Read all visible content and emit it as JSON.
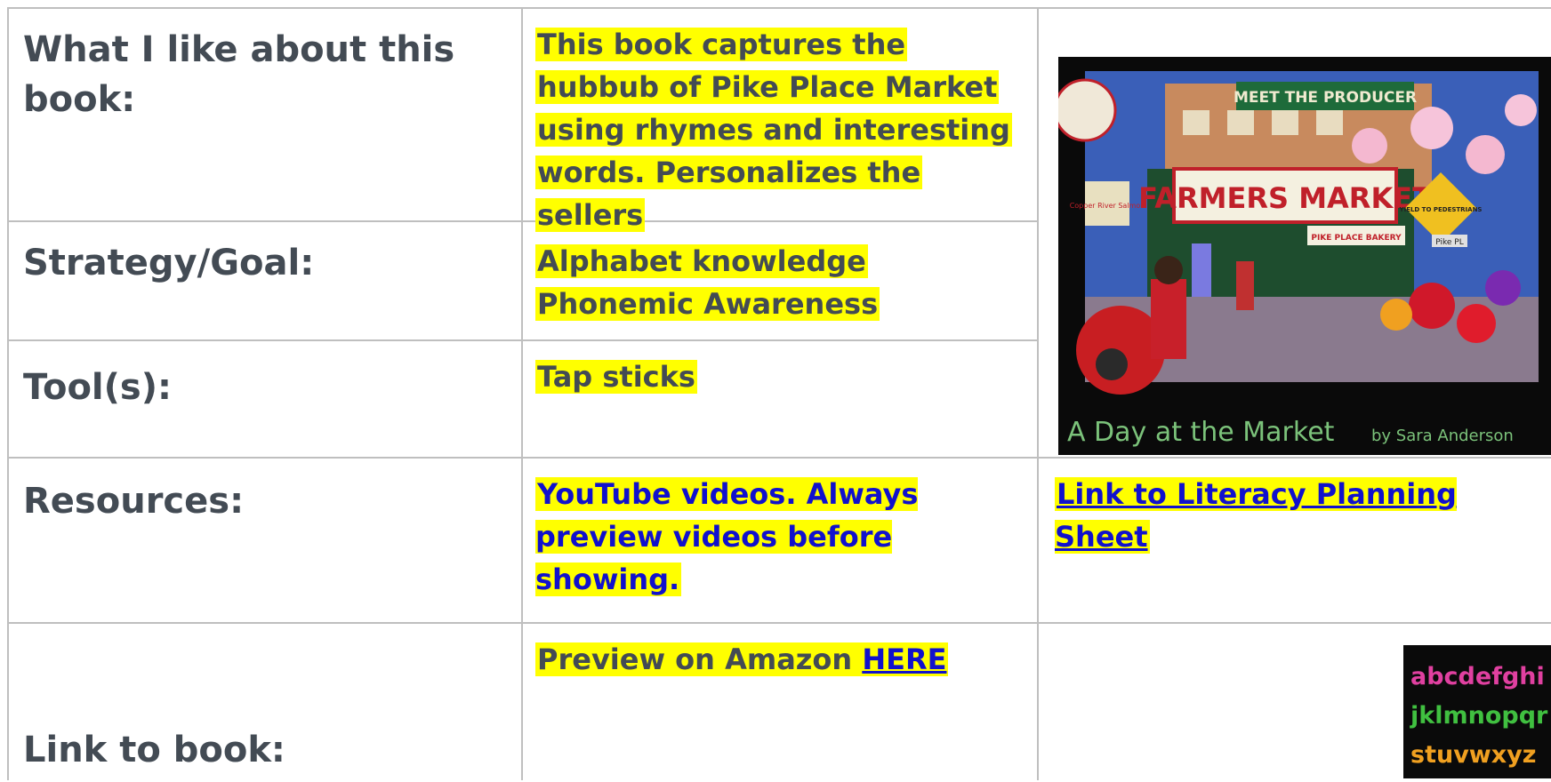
{
  "rows": [
    {
      "label": "What I like about this book:",
      "content": "This book captures the hubbub of Pike Place Market using rhymes and interesting words. Personalizes the sellers"
    },
    {
      "label": "Strategy/Goal:",
      "content_lines": [
        "Alphabet knowledge",
        "Phonemic  Awareness"
      ]
    },
    {
      "label": "Tool(s):",
      "content": "Tap sticks"
    },
    {
      "label": "Resources:",
      "content": "YouTube videos.  Always preview videos before showing.",
      "link_text": "Link to Literacy Planning Sheet"
    },
    {
      "label": "Link to book:",
      "content": "Preview on Amazon ",
      "link_text": "HERE"
    }
  ],
  "cover": {
    "sign_top": "MEET THE PRODUCER",
    "sign_main": "FARMERS MARKET",
    "sign_bakery": "PIKE PLACE BAKERY",
    "sign_yield": "YIELD TO PEDESTRIANS",
    "sign_street": "Pike PL",
    "sign_fish": "Copper River Salmon",
    "title": "A Day at the Market",
    "byline": "by Sara Anderson"
  },
  "alphabet_rows": [
    "abcdefghi",
    "jklmnopqr",
    "stuvwxyz"
  ],
  "colors": {
    "highlight": "#ffff00",
    "link": "#1111cc",
    "label": "#434b54",
    "border": "#bfbfbf"
  }
}
